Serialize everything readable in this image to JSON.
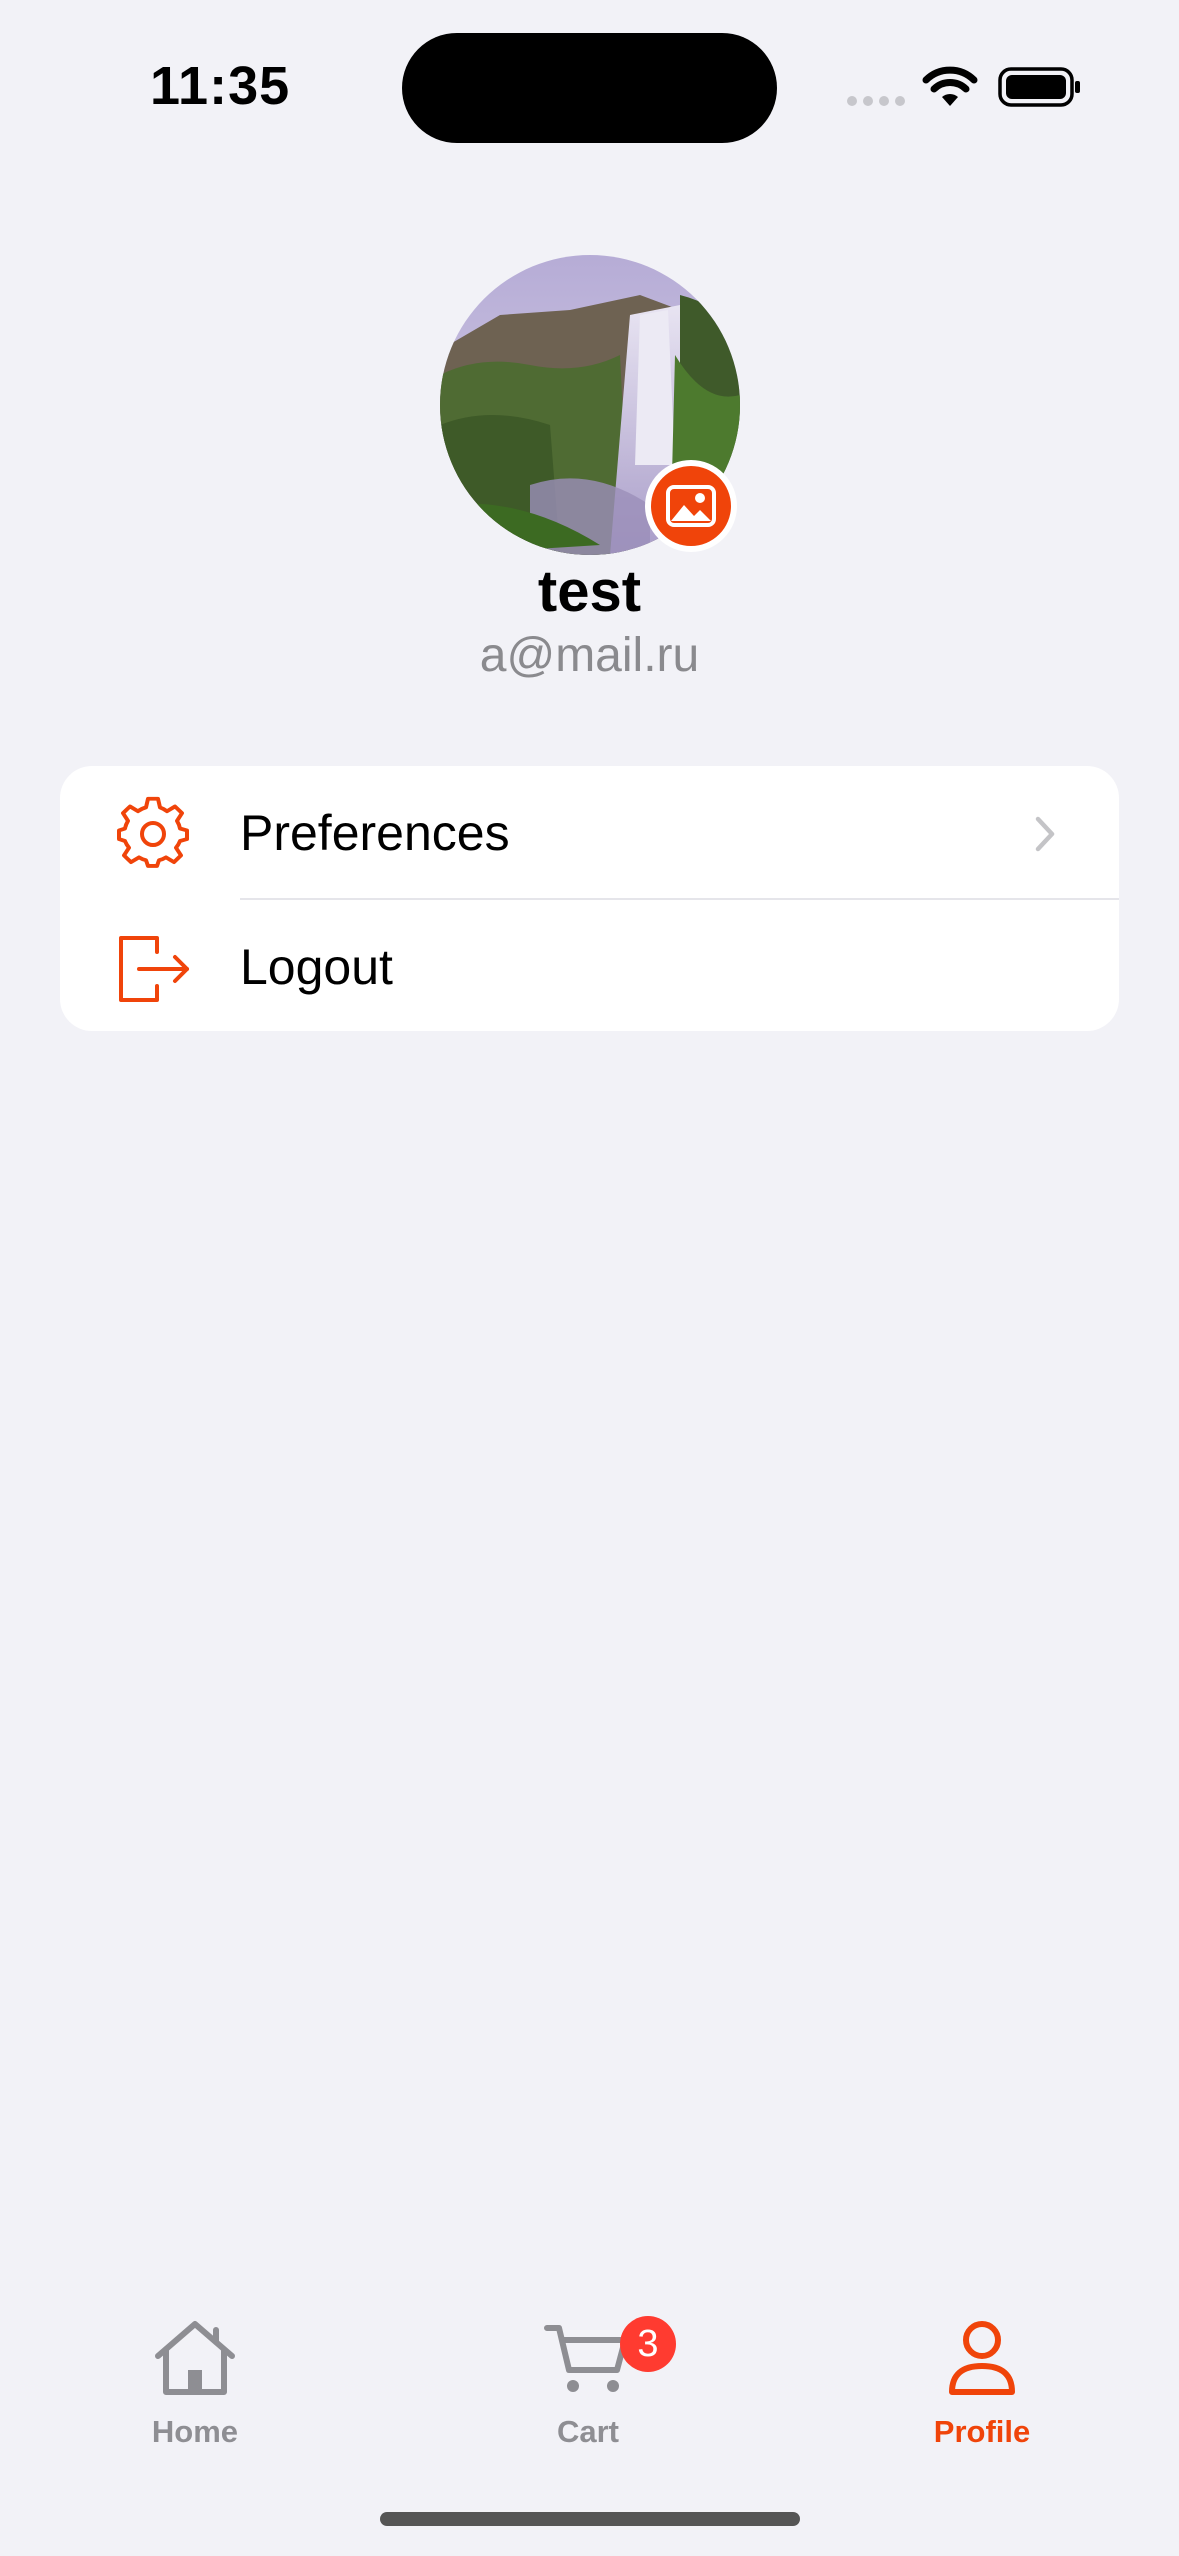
{
  "status_bar": {
    "time": "11:35"
  },
  "profile": {
    "name": "test",
    "email": "a@mail.ru"
  },
  "menu": {
    "items": [
      {
        "label": "Preferences",
        "icon": "gear-icon",
        "has_chevron": true
      },
      {
        "label": "Logout",
        "icon": "logout-icon",
        "has_chevron": false
      }
    ]
  },
  "tab_bar": {
    "tabs": [
      {
        "label": "Home",
        "icon": "house-icon",
        "active": false
      },
      {
        "label": "Cart",
        "icon": "cart-icon",
        "active": false,
        "badge": "3"
      },
      {
        "label": "Profile",
        "icon": "person-icon",
        "active": true
      }
    ]
  },
  "colors": {
    "accent": "#f0440a",
    "background": "#f2f2f7",
    "inactive": "#8e8e93",
    "badge": "#ff3b30"
  }
}
